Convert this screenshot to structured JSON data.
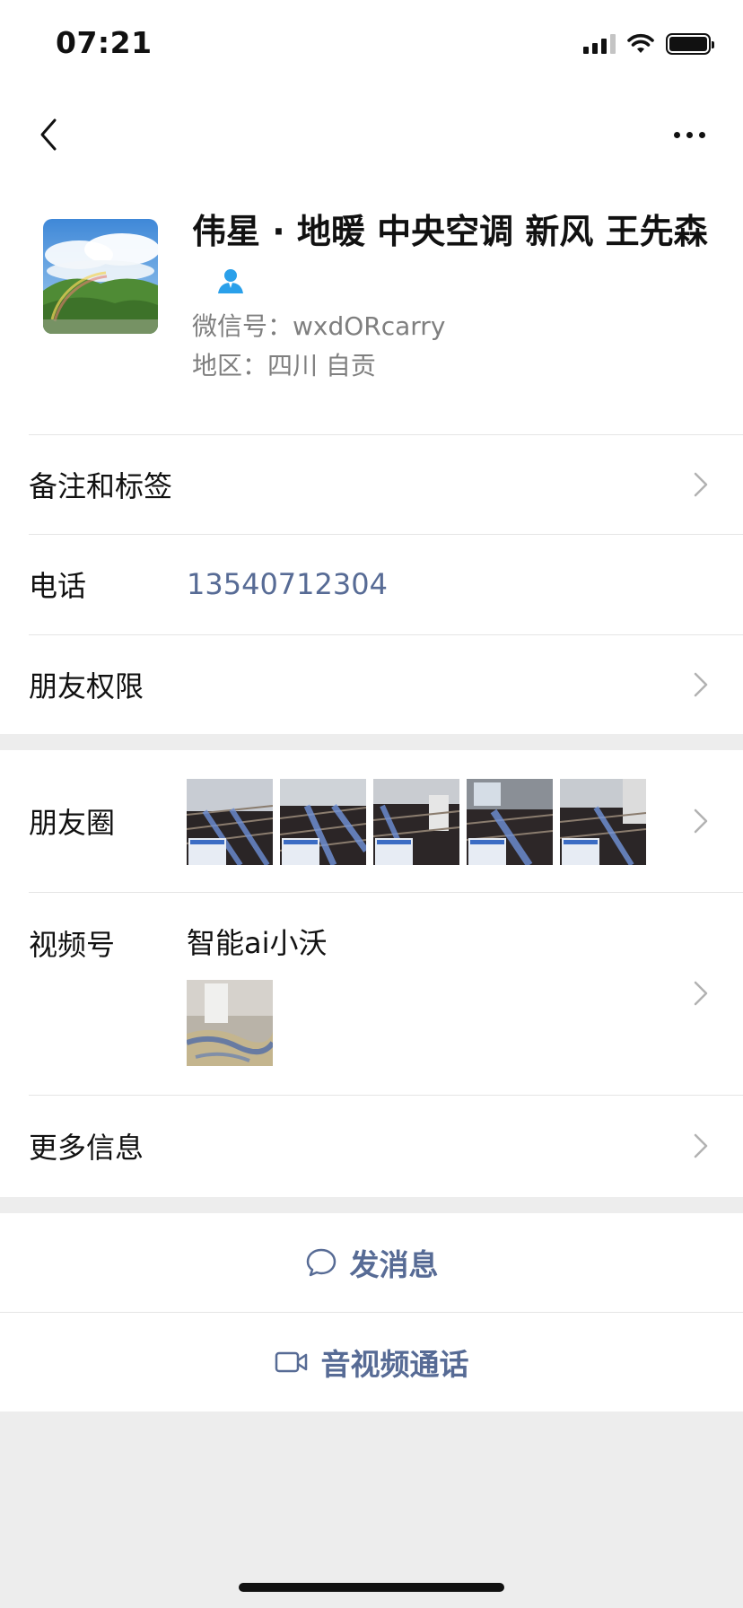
{
  "status_bar": {
    "time": "07:21"
  },
  "nav": {
    "back_icon": "chevron-left-icon",
    "more_icon": "more-dots-icon"
  },
  "profile": {
    "name": "伟星 · 地暖 中央空调 新风 王先森",
    "wechat_id": "微信号：wxdORcarry",
    "region": "地区：四川 自贡",
    "verify_icon": "person-icon",
    "verify_color": "#2aa0ea"
  },
  "cells": {
    "remarks": {
      "label": "备注和标签"
    },
    "phone": {
      "label": "电话",
      "value": "13540712304"
    },
    "permissions": {
      "label": "朋友权限"
    },
    "moments": {
      "label": "朋友圈"
    },
    "channels": {
      "label": "视频号",
      "name": "智能ai小沃"
    },
    "more_info": {
      "label": "更多信息"
    }
  },
  "actions": {
    "message": {
      "label": "发消息",
      "icon": "chat-bubble-icon"
    },
    "call": {
      "label": "音视频通话",
      "icon": "video-camera-icon"
    }
  },
  "colors": {
    "link": "#576b95",
    "background": "#ededed",
    "divider": "#e5e5e5"
  }
}
